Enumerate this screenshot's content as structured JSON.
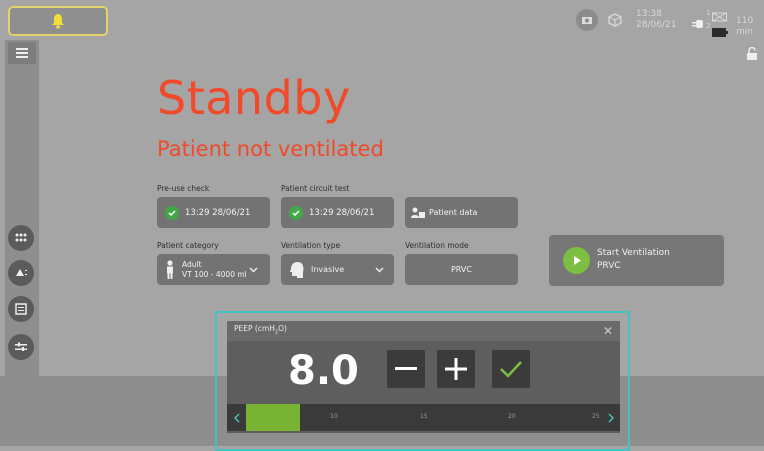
{
  "top": {
    "time": "13:38",
    "date": "28/06/21",
    "battery_minutes": "110 min",
    "battery_slot1": "1",
    "battery_slot2": "2"
  },
  "main": {
    "title": "Standby",
    "subtitle": "Patient not ventilated",
    "preuse_label": "Pre-use check",
    "preuse_value": "13:29 28/06/21",
    "circuit_label": "Patient circuit test",
    "circuit_value": "13:29 28/06/21",
    "patient_data": "Patient data",
    "category_label": "Patient category",
    "category_line1": "Adult",
    "category_line2": "VT 100 - 4000 ml",
    "vent_type_label": "Ventilation type",
    "vent_type_value": "Invasive",
    "vent_mode_label": "Ventilation mode",
    "vent_mode_value": "PRVC",
    "start_title": "Start Ventilation",
    "start_mode": "PRVC"
  },
  "dialog": {
    "title_pre": "PEEP (cmH",
    "title_sub": "2",
    "title_post": "O)",
    "value": "8.0",
    "level": 8,
    "range": [
      5,
      26
    ],
    "ticks": [
      "10",
      "15",
      "20",
      "25"
    ]
  },
  "colors": {
    "accent_red": "#f04a2a",
    "highlight": "#45c1c0",
    "check_green": "#44a647",
    "bar_green": "#78b333",
    "alarm_yellow": "#e2d36a"
  }
}
